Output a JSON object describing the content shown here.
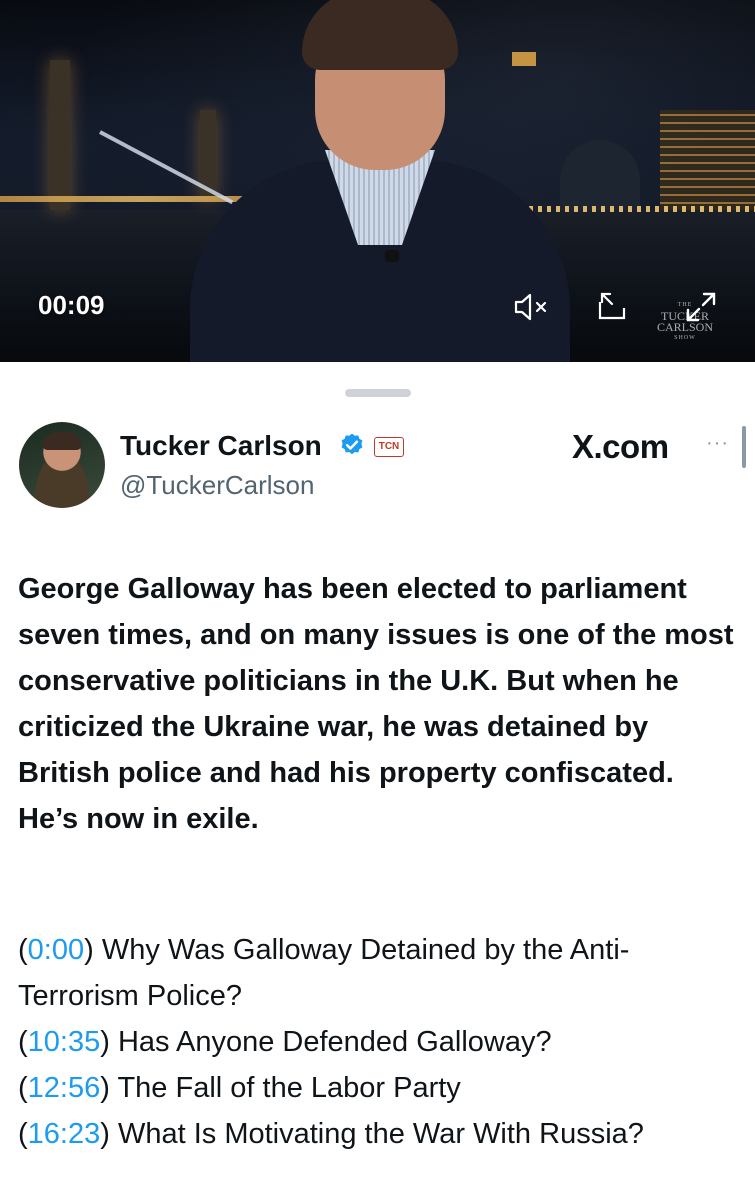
{
  "video": {
    "timestamp": "00:09",
    "controls": {
      "mute_icon": "volume-muted-icon",
      "pip_icon": "picture-in-picture-icon",
      "expand_icon": "expand-icon"
    },
    "watermark": {
      "line1": "THE",
      "line2": "TUCKER",
      "line3": "CARLSON",
      "line4": "SHOW"
    }
  },
  "author": {
    "display_name": "Tucker Carlson",
    "handle": "@TuckerCarlson",
    "affiliate_badge": "TCN",
    "verified_color": "#1d9bf0"
  },
  "source": {
    "site": "X.com",
    "more_label": "···"
  },
  "post": {
    "text": "George Galloway has been elected to parliament seven times, and on many issues is one of the most conservative politicians in the U.K. But when he criticized the Ukraine war, he was detained by British police and had his property confiscated. He’s now in exile."
  },
  "chapters": [
    {
      "time": "0:00",
      "title": "Why Was Galloway Detained by the Anti-Terrorism Police?"
    },
    {
      "time": "10:35",
      "title": "Has Anyone Defended Galloway?"
    },
    {
      "time": "12:56",
      "title": "The Fall of the Labor Party"
    },
    {
      "time": "16:23",
      "title": "What Is Motivating the War With Russia?"
    }
  ],
  "colors": {
    "link": "#1d9bf0",
    "text": "#0f1419",
    "secondary": "#536471"
  }
}
